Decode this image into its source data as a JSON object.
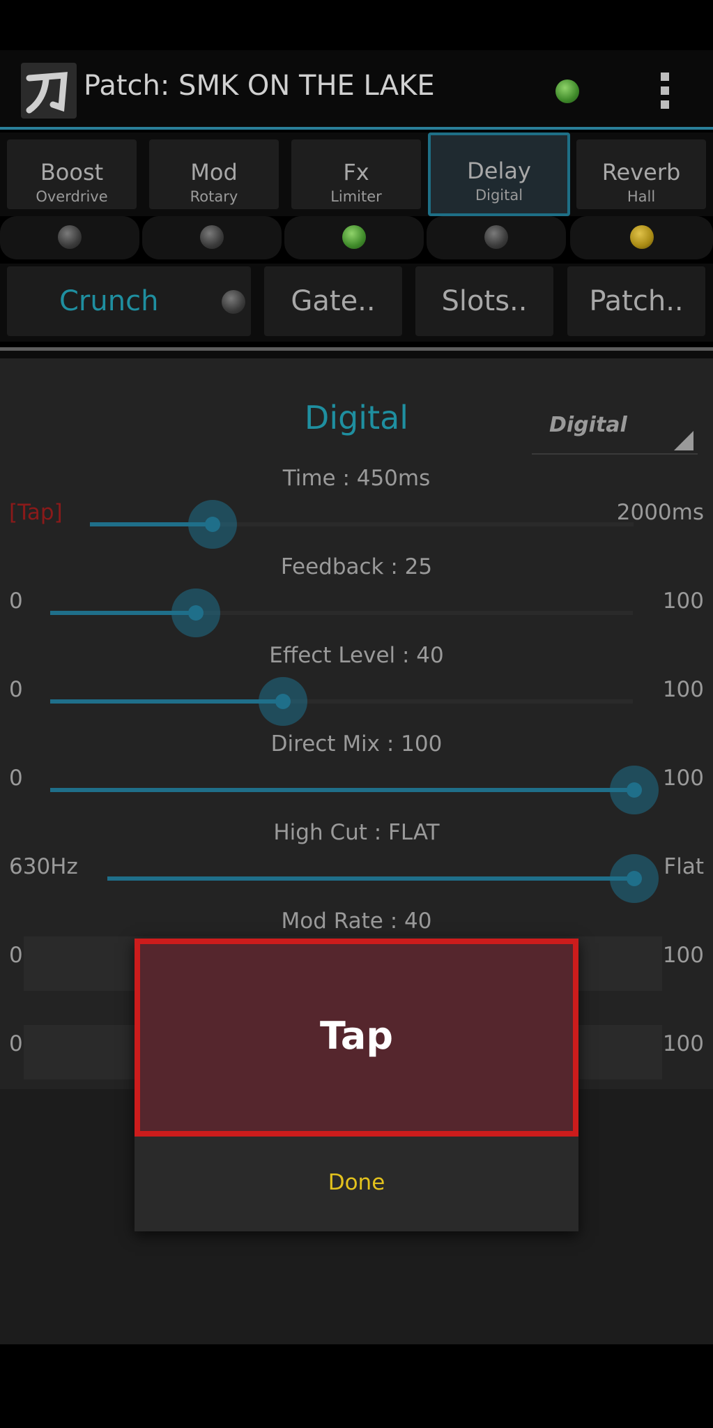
{
  "header": {
    "title": "Patch: SMK ON THE LAKE"
  },
  "fx_tabs": [
    {
      "name": "Boost",
      "sub": "Overdrive"
    },
    {
      "name": "Mod",
      "sub": "Rotary"
    },
    {
      "name": "Fx",
      "sub": "Limiter"
    },
    {
      "name": "Delay",
      "sub": "Digital"
    },
    {
      "name": "Reverb",
      "sub": "Hall"
    }
  ],
  "leds": [
    "off",
    "off",
    "green",
    "off",
    "yellow"
  ],
  "buttons": {
    "crunch": "Crunch",
    "gate": "Gate..",
    "slots": "Slots..",
    "patch": "Patch.."
  },
  "panel": {
    "fx_name": "Digital",
    "type_value": "Digital",
    "params": [
      {
        "title": "Time : 450ms",
        "min": "[Tap]",
        "max": "2000ms",
        "value": 450,
        "range": [
          0,
          2000
        ]
      },
      {
        "title": "Feedback : 25",
        "min": "0",
        "max": "100",
        "value": 25,
        "range": [
          0,
          100
        ]
      },
      {
        "title": "Effect Level : 40",
        "min": "0",
        "max": "100",
        "value": 40,
        "range": [
          0,
          100
        ]
      },
      {
        "title": "Direct Mix : 100",
        "min": "0",
        "max": "100",
        "value": 100,
        "range": [
          0,
          100
        ]
      },
      {
        "title": "High Cut : FLAT",
        "min": "630Hz",
        "max": "Flat",
        "value": 1,
        "range": [
          0,
          1
        ]
      },
      {
        "title": "Mod Rate : 40",
        "min": "0",
        "max": "100"
      },
      {
        "title": "",
        "min": "0",
        "max": "100"
      }
    ]
  },
  "dialog": {
    "tap_label": "Tap",
    "done_label": "Done"
  },
  "colors": {
    "accent": "#1f8fa0",
    "tap_border": "#cc1c1c",
    "done_text": "#e3c21d"
  }
}
